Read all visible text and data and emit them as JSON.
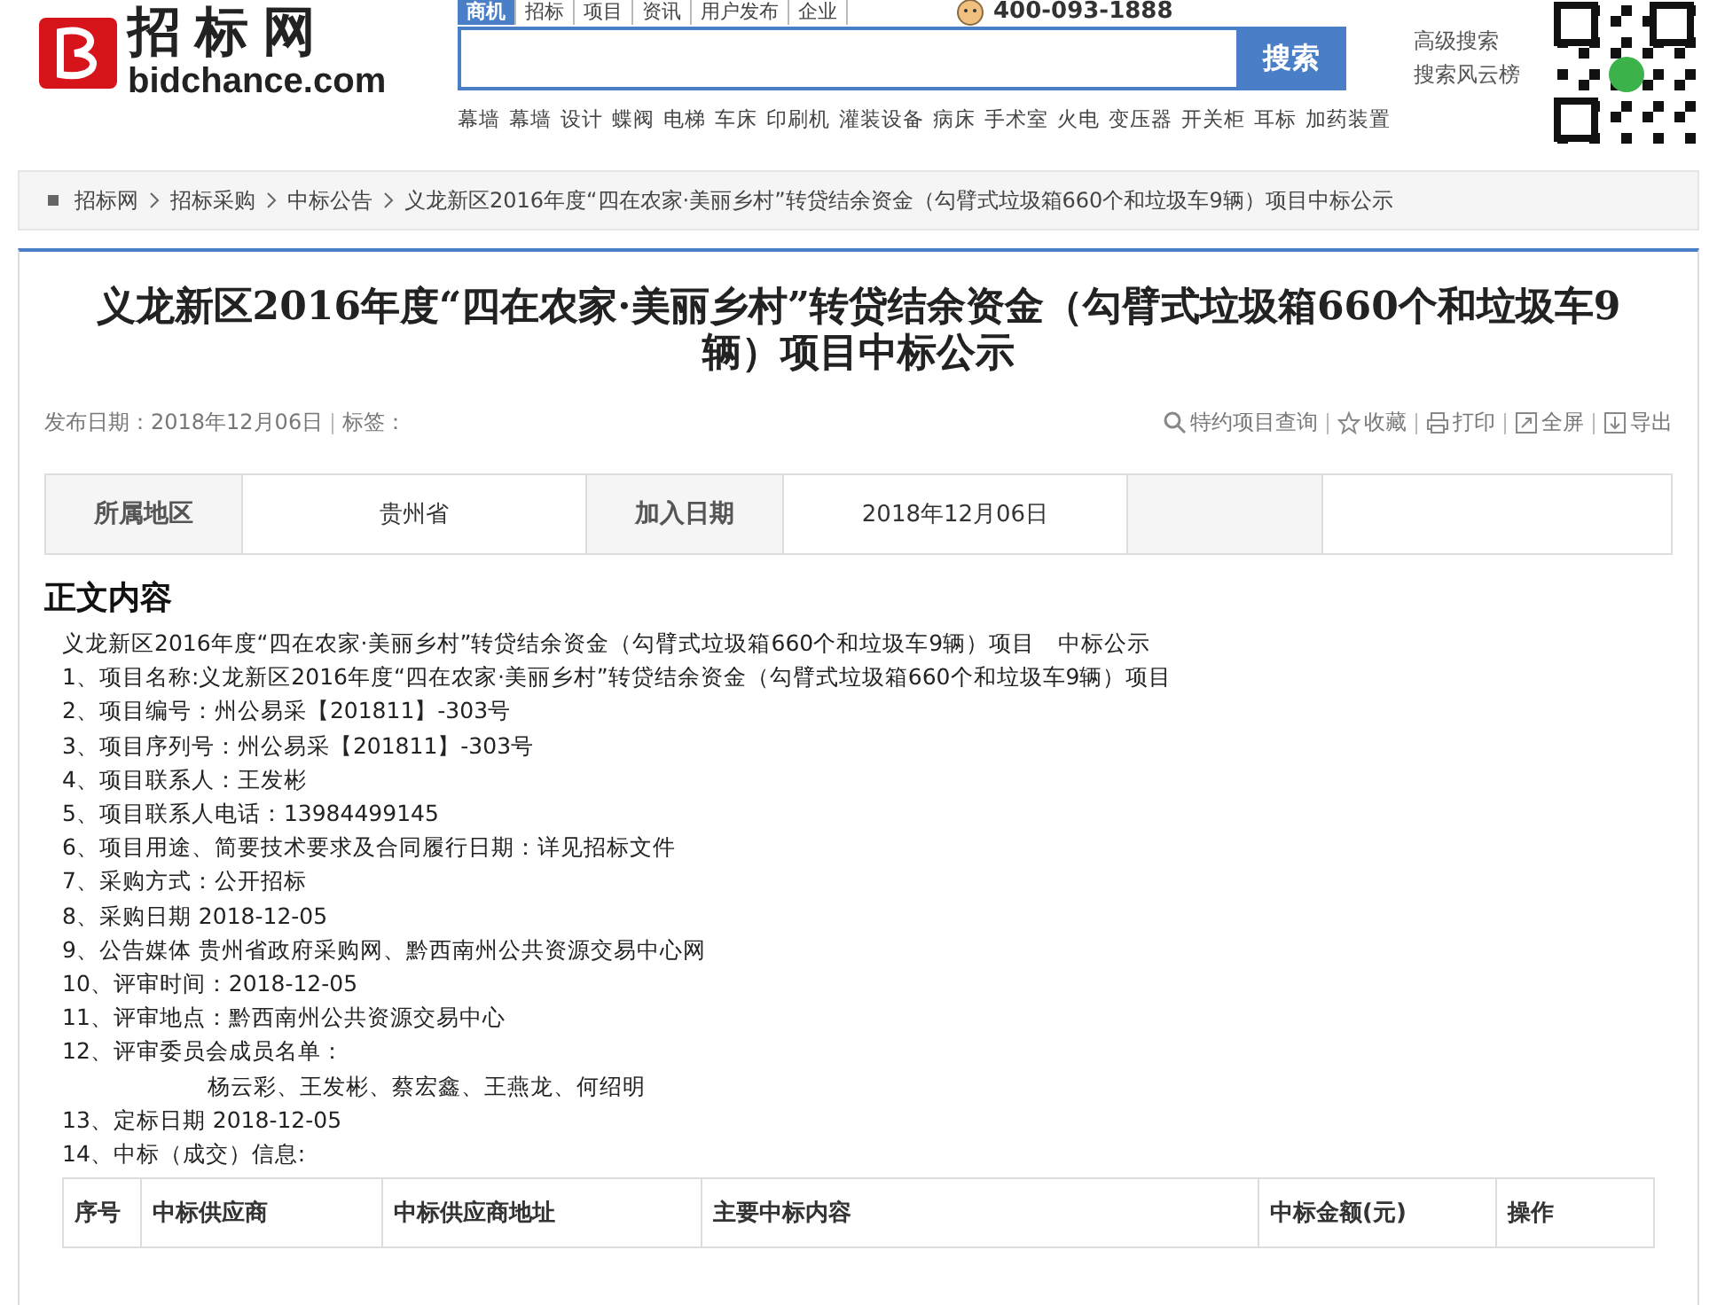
{
  "header": {
    "logo_cn": "招标网",
    "logo_en": "bidchance.com",
    "nav_tabs": [
      {
        "label": "商机",
        "selected": true
      },
      {
        "label": "招标",
        "selected": false
      },
      {
        "label": "项目",
        "selected": false
      },
      {
        "label": "资讯",
        "selected": false
      },
      {
        "label": "用户发布",
        "selected": false
      },
      {
        "label": "企业",
        "selected": false
      }
    ],
    "phone": "400-093-1888",
    "search_button": "搜索",
    "links": [
      "高级搜索",
      "搜索风云榜"
    ],
    "hot_keywords": [
      "幕墙",
      "幕墙",
      "设计",
      "蝶阀",
      "电梯",
      "车床",
      "印刷机",
      "灌装设备",
      "病床",
      "手术室",
      "火电",
      "变压器",
      "开关柜",
      "耳标",
      "加药装置"
    ]
  },
  "breadcrumb": [
    "招标网",
    "招标采购",
    "中标公告",
    "义龙新区2016年度“四在农家·美丽乡村”转贷结余资金（勾臂式垃圾箱660个和垃圾车9辆）项目中标公示"
  ],
  "article": {
    "title": "义龙新区2016年度“四在农家·美丽乡村”转贷结余资金（勾臂式垃圾箱660个和垃圾车9辆）项目中标公示",
    "meta": [
      "发布日期：2018年12月06日",
      "标签："
    ],
    "actions": [
      {
        "kind": "search",
        "label": "特约项目查询"
      },
      {
        "kind": "star",
        "label": "收藏"
      },
      {
        "kind": "print",
        "label": "打印"
      },
      {
        "kind": "fullscreen",
        "label": "全屏"
      },
      {
        "kind": "export",
        "label": "导出"
      }
    ],
    "info": [
      {
        "label": "所属地区",
        "value": "贵州省"
      },
      {
        "label": "加入日期",
        "value": "2018年12月06日"
      }
    ],
    "section_title": "正文内容",
    "lines": [
      {
        "text": "义龙新区2016年度“四在农家·美丽乡村”转贷结余资金（勾臂式垃圾箱660个和垃圾车9辆）项目　中标公示",
        "indent": false
      },
      {
        "text": "1、项目名称:义龙新区2016年度“四在农家·美丽乡村”转贷结余资金（勾臂式垃圾箱660个和垃圾车9辆）项目",
        "indent": false
      },
      {
        "text": "2、项目编号：州公易采【201811】-303号",
        "indent": false
      },
      {
        "text": "3、项目序列号：州公易采【201811】-303号",
        "indent": false
      },
      {
        "text": "4、项目联系人：王发彬",
        "indent": false
      },
      {
        "text": "5、项目联系人电话：13984499145",
        "indent": false
      },
      {
        "text": "6、项目用途、简要技术要求及合同履行日期：详见招标文件",
        "indent": false
      },
      {
        "text": "7、采购方式：公开招标",
        "indent": false
      },
      {
        "text": "8、采购日期 2018-12-05",
        "indent": false
      },
      {
        "text": "9、公告媒体 贵州省政府采购网、黔西南州公共资源交易中心网",
        "indent": false
      },
      {
        "text": "10、评审时间：2018-12-05",
        "indent": false
      },
      {
        "text": "11、评审地点：黔西南州公共资源交易中心",
        "indent": false
      },
      {
        "text": "12、评审委员会成员名单：",
        "indent": false
      },
      {
        "text": "杨云彩、王发彬、蔡宏鑫、王燕龙、何绍明",
        "indent": true
      },
      {
        "text": "13、定标日期 2018-12-05",
        "indent": false
      },
      {
        "text": "14、中标（成交）信息:",
        "indent": false
      }
    ],
    "table": {
      "columns": [
        "序号",
        "中标供应商",
        "中标供应商地址",
        "主要中标内容",
        "中标金额(元)",
        "操作"
      ]
    }
  }
}
